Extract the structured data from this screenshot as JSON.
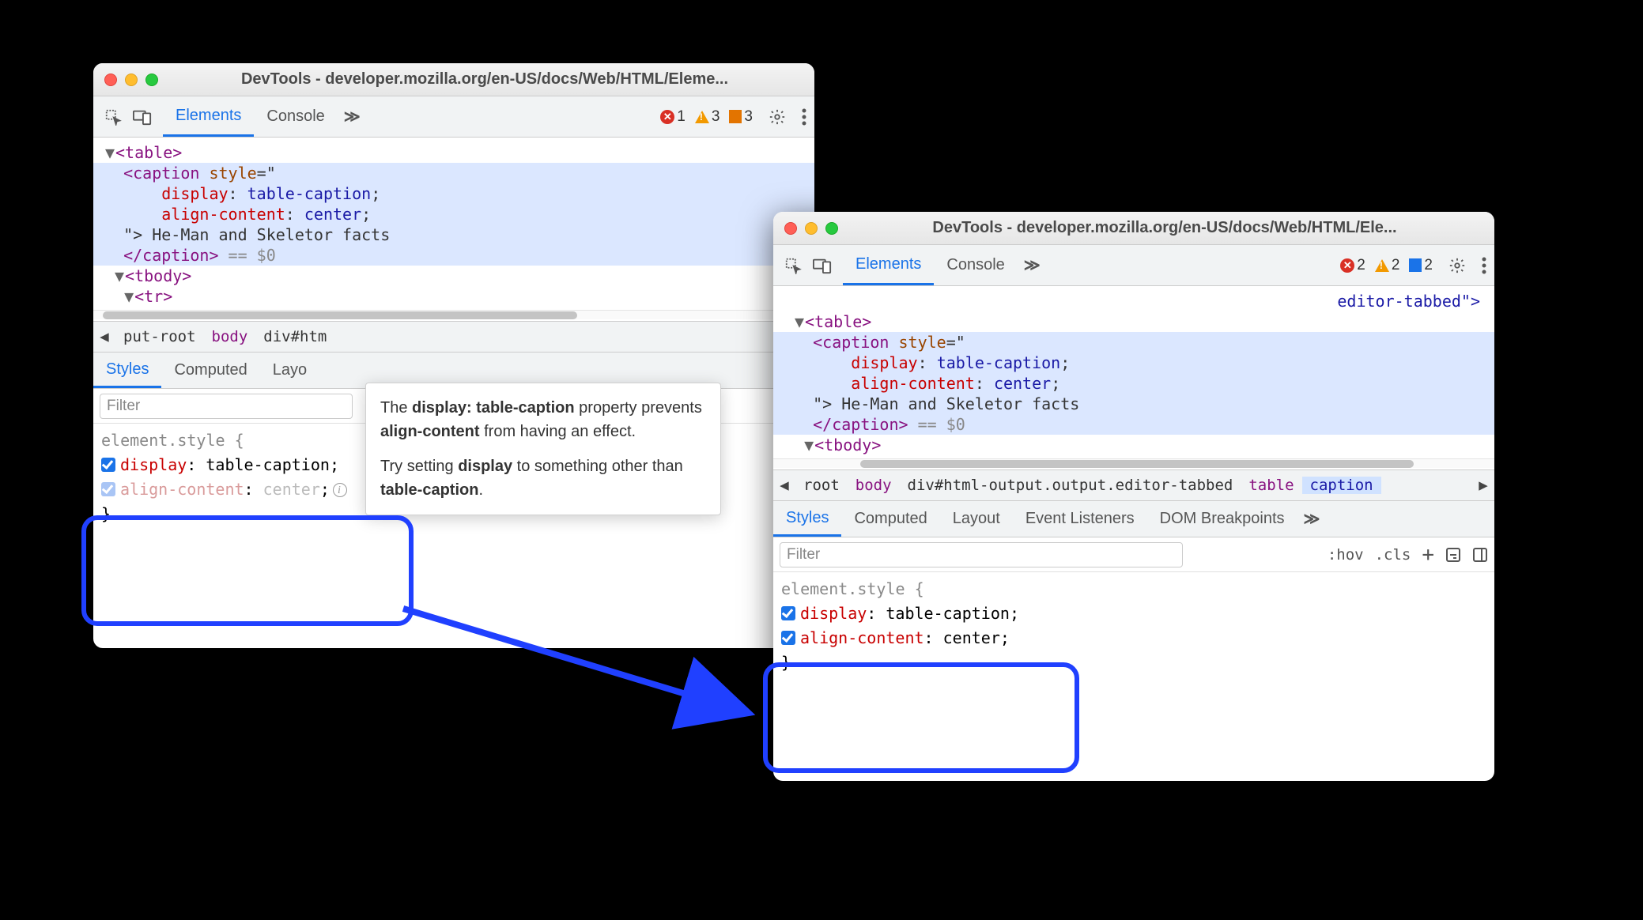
{
  "win1": {
    "title": "DevTools - developer.mozilla.org/en-US/docs/Web/HTML/Eleme...",
    "tabs": {
      "elements": "Elements",
      "console": "Console"
    },
    "issues": {
      "errors": 1,
      "warnings": 3,
      "info": 3
    },
    "dom": {
      "table_open": "<table>",
      "caption_open": "<caption",
      "style_attr": " style",
      "eq_quote": "=\"",
      "css_line1_prop": "display",
      "css_line1_val": "table-caption",
      "css_line2_prop": "align-content",
      "css_line2_val": "center",
      "close_quote_text": "\"> He-Man and Skeletor facts",
      "caption_close": "</caption>",
      "eq_dollar": " == $0",
      "tbody_open": "<tbody>",
      "tr_open": "<tr>"
    },
    "crumbs": {
      "a": "put-root",
      "b": "body",
      "c": "div#htm"
    },
    "subtabs": {
      "styles": "Styles",
      "computed": "Computed",
      "layout": "Layo"
    },
    "filter_placeholder": "Filter",
    "styles": {
      "selector": "element.style {",
      "p1": "display",
      "v1": "table-caption",
      "p2": "align-content",
      "v2": "center",
      "close": "}"
    },
    "tooltip": {
      "line1a": "The ",
      "line1b": "display: table-caption",
      "line1c": " property prevents ",
      "line1d": "align-content",
      "line1e": " from having an effect.",
      "line2a": "Try setting ",
      "line2b": "display",
      "line2c": " to something other than ",
      "line2d": "table-caption",
      "line2e": "."
    }
  },
  "win2": {
    "title": "DevTools - developer.mozilla.org/en-US/docs/Web/HTML/Ele...",
    "tabs": {
      "elements": "Elements",
      "console": "Console"
    },
    "issues": {
      "errors": 2,
      "warnings": 2,
      "info": 2
    },
    "dom": {
      "prev_line": "editor-tabbed\">",
      "table_open": "<table>",
      "caption_open": "<caption",
      "style_attr": " style",
      "eq_quote": "=\"",
      "css_line1_prop": "display",
      "css_line1_val": "table-caption",
      "css_line2_prop": "align-content",
      "css_line2_val": "center",
      "close_quote_text": "\"> He-Man and Skeletor facts",
      "caption_close": "</caption>",
      "eq_dollar": " == $0",
      "tbody_open": "<tbody>"
    },
    "crumbs": {
      "a": "root",
      "b": "body",
      "c": "div#html-output.output.editor-tabbed",
      "d": "table",
      "e": "caption"
    },
    "subtabs": {
      "styles": "Styles",
      "computed": "Computed",
      "layout": "Layout",
      "events": "Event Listeners",
      "dom": "DOM Breakpoints"
    },
    "filter_placeholder": "Filter",
    "hov": ":hov",
    "cls": ".cls",
    "styles": {
      "selector": "element.style {",
      "p1": "display",
      "v1": "table-caption",
      "p2": "align-content",
      "v2": "center",
      "close": "}"
    }
  }
}
